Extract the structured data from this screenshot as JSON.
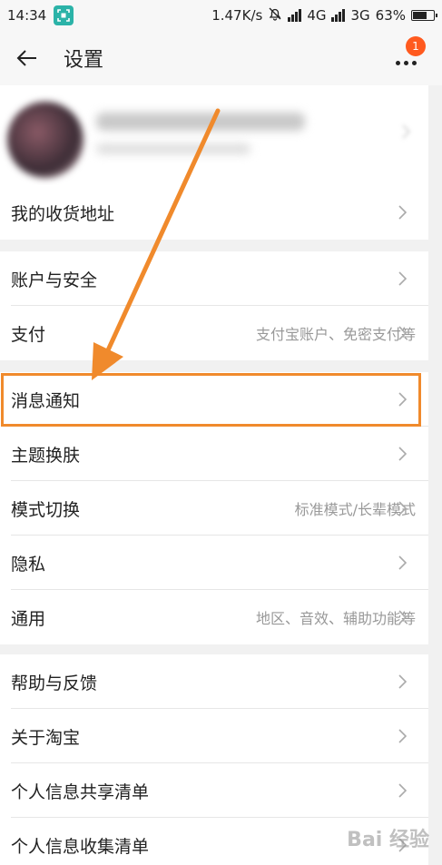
{
  "status_bar": {
    "time": "14:34",
    "speed": "1.47K/s",
    "net1": "4G",
    "net2": "3G",
    "battery": "63%"
  },
  "nav": {
    "title": "设置",
    "badge_count": "1"
  },
  "sections": {
    "address": {
      "label": "我的收货地址"
    },
    "account": {
      "label": "账户与安全"
    },
    "pay": {
      "label": "支付",
      "value": "支付宝账户、免密支付等"
    },
    "notify": {
      "label": "消息通知"
    },
    "theme": {
      "label": "主题换肤"
    },
    "mode": {
      "label": "模式切换",
      "value": "标准模式/长辈模式"
    },
    "privacy": {
      "label": "隐私"
    },
    "general": {
      "label": "通用",
      "value": "地区、音效、辅助功能等"
    },
    "help": {
      "label": "帮助与反馈"
    },
    "about": {
      "label": "关于淘宝"
    },
    "share_list": {
      "label": "个人信息共享清单"
    },
    "collect_list": {
      "label": "个人信息收集清单"
    }
  },
  "watermark": "Bai 经验",
  "colors": {
    "accent": "#f08a2c",
    "badge": "#ff5a1f",
    "scan_badge": "#2bb3a8"
  }
}
